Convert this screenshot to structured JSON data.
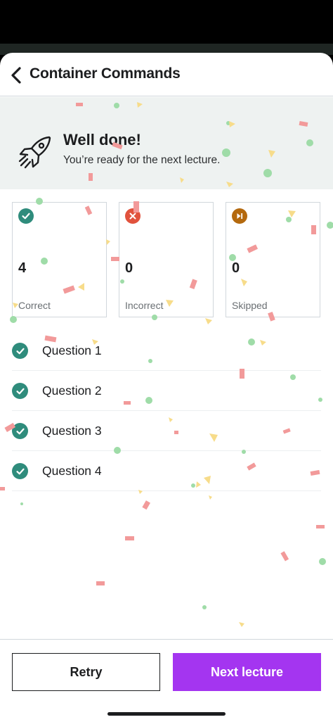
{
  "header": {
    "title": "Container Commands",
    "back_icon": "chevron-left-icon"
  },
  "banner": {
    "title": "Well done!",
    "subtitle": "You’re ready for the next lecture.",
    "icon": "rocket-icon"
  },
  "stats": [
    {
      "value": "4",
      "label": "Correct",
      "icon": "check-circle-icon",
      "color": "#2f8c7c"
    },
    {
      "value": "0",
      "label": "Incorrect",
      "icon": "x-circle-icon",
      "color": "#e1523d"
    },
    {
      "value": "0",
      "label": "Skipped",
      "icon": "skip-circle-icon",
      "color": "#b4690e"
    }
  ],
  "questions": [
    {
      "label": "Question 1",
      "status": "correct"
    },
    {
      "label": "Question 2",
      "status": "correct"
    },
    {
      "label": "Question 3",
      "status": "correct"
    },
    {
      "label": "Question 4",
      "status": "correct"
    }
  ],
  "footer": {
    "retry_label": "Retry",
    "next_label": "Next lecture"
  },
  "colors": {
    "accent": "#a435f0",
    "success": "#2f8c7c",
    "error": "#e1523d",
    "warning": "#b4690e",
    "banner_bg": "#eef2f1"
  }
}
